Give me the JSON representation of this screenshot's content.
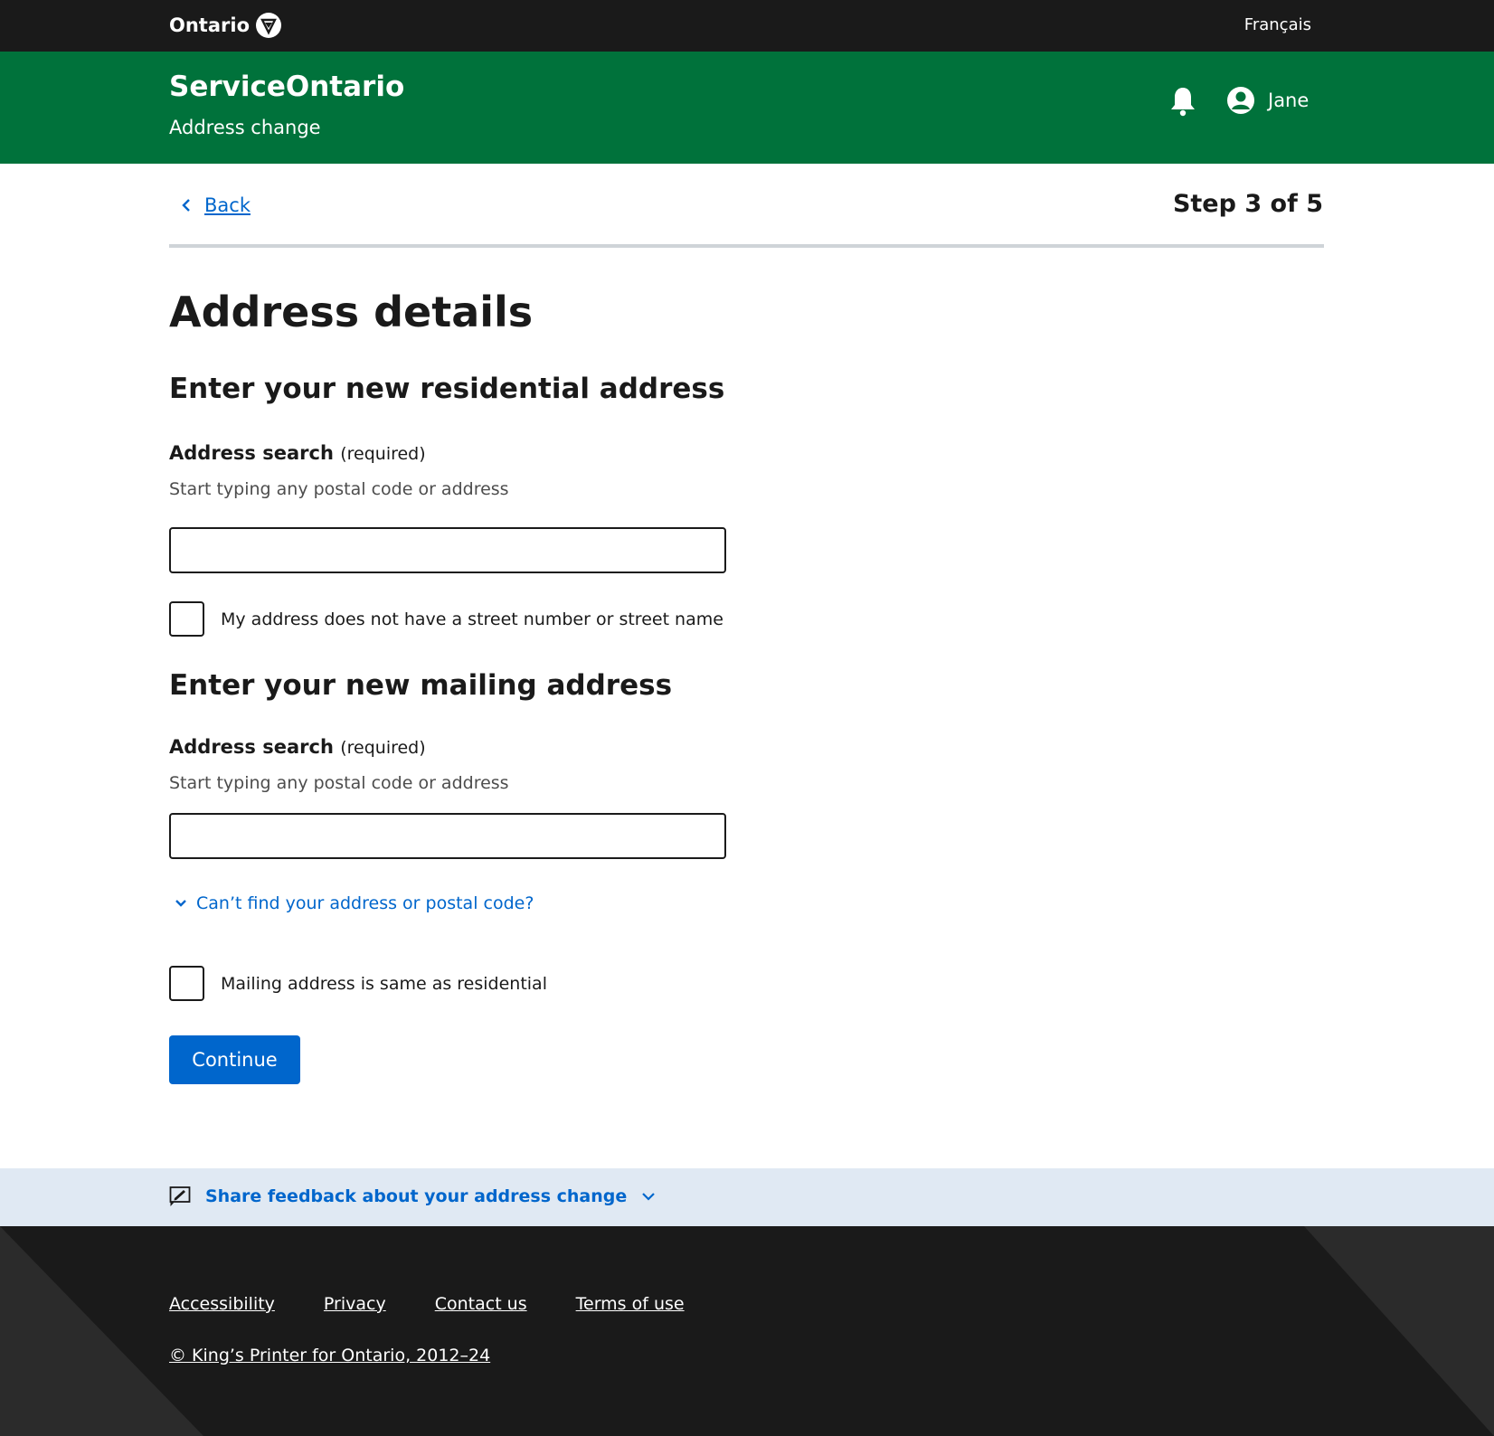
{
  "topbar": {
    "brand": "Ontario",
    "language": "Français"
  },
  "header": {
    "service": "ServiceOntario",
    "subtitle": "Address change",
    "user": "Jane"
  },
  "nav": {
    "back": "Back",
    "step": "Step 3 of 5"
  },
  "page": {
    "title": "Address details"
  },
  "residential": {
    "heading": "Enter your new residential address",
    "label": "Address search",
    "required": "(required)",
    "hint": "Start typing any postal code or address",
    "value": "",
    "checkbox_label": "My address does not have a street number or street name"
  },
  "mailing": {
    "heading": "Enter your new mailing address",
    "label": "Address search",
    "required": "(required)",
    "hint": "Start typing any postal code or address",
    "value": "",
    "expander": "Can’t find your address or postal code?",
    "checkbox_label": "Mailing address is same as residential"
  },
  "actions": {
    "continue": "Continue"
  },
  "feedback": {
    "label": "Share feedback about your address change"
  },
  "footer": {
    "links": [
      "Accessibility",
      "Privacy",
      "Contact us",
      "Terms of use"
    ],
    "copyright": "© King’s Printer for Ontario, 2012–24"
  },
  "colors": {
    "green": "#00723b",
    "blue": "#0066cc",
    "dark": "#1a1a1a",
    "feedback_bg": "#e0e9f3"
  },
  "icons": [
    "ontario-trillium-icon",
    "bell-icon",
    "user-icon",
    "chevron-left-icon",
    "chevron-down-icon",
    "feedback-icon"
  ]
}
